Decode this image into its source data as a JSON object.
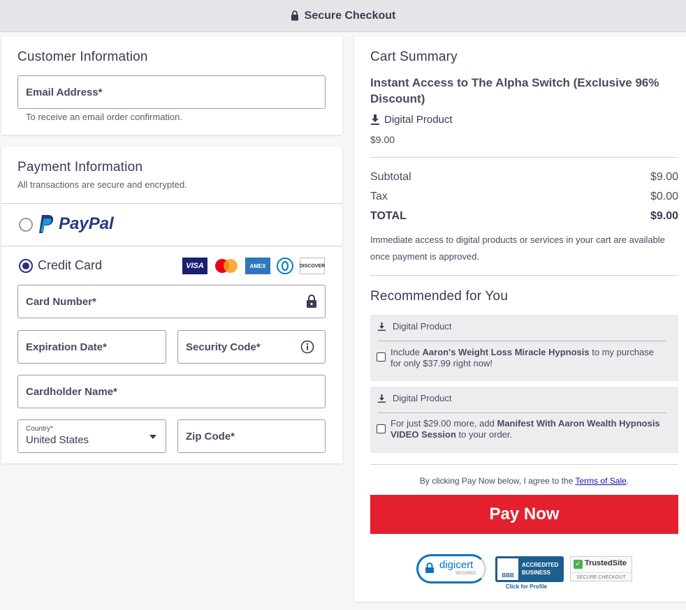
{
  "header": {
    "title": "Secure Checkout"
  },
  "customer": {
    "title": "Customer Information",
    "email_label": "Email Address*",
    "email_hint": "To receive an email order confirmation."
  },
  "payment": {
    "title": "Payment Information",
    "subtitle": "All transactions are secure and encrypted.",
    "paypal_label": "PayPal",
    "credit_label": "Credit Card",
    "card_logos": [
      "VISA",
      "Mastercard",
      "AMEX",
      "Diners",
      "DISCOVER"
    ],
    "card_number_label": "Card Number*",
    "expiration_label": "Expiration Date*",
    "security_label": "Security Code*",
    "cardholder_label": "Cardholder Name*",
    "country_label": "Country*",
    "country_value": "United States",
    "zip_label": "Zip Code*"
  },
  "cart": {
    "title": "Cart Summary",
    "product_name": "Instant Access to The Alpha Switch (Exclusive 96% Discount)",
    "product_type": "Digital Product",
    "product_price": "$9.00",
    "subtotal_label": "Subtotal",
    "subtotal_value": "$9.00",
    "tax_label": "Tax",
    "tax_value": "$0.00",
    "total_label": "TOTAL",
    "total_value": "$9.00",
    "note": "Immediate access to digital products or services in your cart are available once payment is approved."
  },
  "recommended": {
    "title": "Recommended for You",
    "items": [
      {
        "type": "Digital Product",
        "pre": "Include ",
        "bold": "Aaron's Weight Loss Miracle Hypnosis",
        "post": " to my purchase for only $37.99 right now!"
      },
      {
        "type": "Digital Product",
        "pre": "For just $29.00 more, add ",
        "bold": "Manifest With Aaron Wealth Hypnosis VIDEO Session",
        "post": " to your order."
      }
    ]
  },
  "terms": {
    "pre": "By clicking Pay Now below, I agree to the ",
    "link": "Terms of Sale",
    "post": "."
  },
  "pay_button": "Pay Now",
  "trust": {
    "digicert": "digicert",
    "digicert_sub": "SECURED",
    "bbb_1": "ACCREDITED",
    "bbb_2": "BUSINESS",
    "bbb_logo": "BBB",
    "bbb_link": "Click for Profile",
    "trusted": "TrustedSite",
    "trusted_sub": "SECURE CHECKOUT"
  },
  "colors": {
    "accent": "#2c2c8c",
    "pay": "#e4202e",
    "paypal_dark": "#253b80",
    "paypal_light": "#179bd7"
  }
}
